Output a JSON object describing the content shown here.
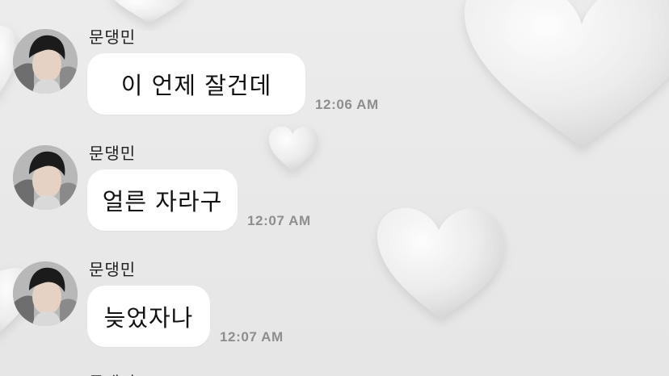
{
  "colors": {
    "background": "#e9e9e9",
    "bubble": "#ffffff",
    "message_text": "#111111",
    "timestamp": "#8e8e8e",
    "sender": "#1f1f1f"
  },
  "messages": [
    {
      "sender": "문댕민",
      "text": "이 언제 잘건데",
      "time": "12:06 AM",
      "avatar": "avatar-photo"
    },
    {
      "sender": "문댕민",
      "text": "얼른 자라구",
      "time": "12:07 AM",
      "avatar": "avatar-photo"
    },
    {
      "sender": "문댕민",
      "text": "늦었자나",
      "time": "12:07 AM",
      "avatar": "avatar-photo"
    }
  ],
  "next_sender_partial": "문댕민",
  "wallpaper": {
    "icon": "heart-icon"
  }
}
